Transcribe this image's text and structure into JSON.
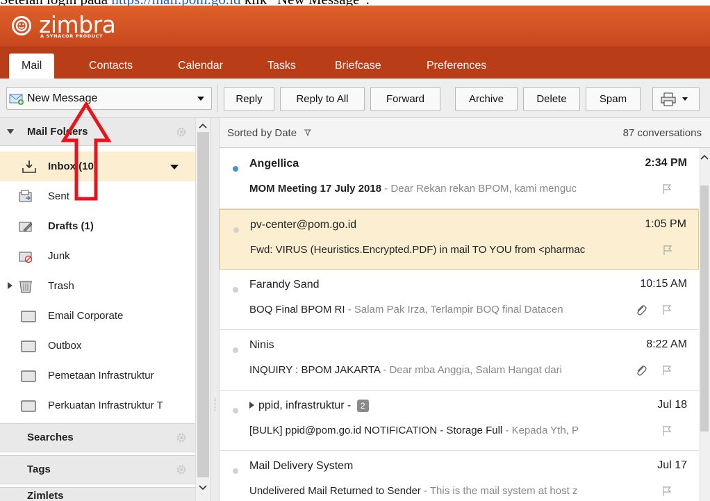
{
  "caption": {
    "prefix": "Setelah login pada ",
    "link": "https://mail.pom.go.id",
    "suffix": " klik “New Message”."
  },
  "header": {
    "logo_text": "zimbra",
    "logo_sub": "A SYNACOR PRODUCT"
  },
  "app_tabs": [
    "Mail",
    "Contacts",
    "Calendar",
    "Tasks",
    "Briefcase",
    "Preferences"
  ],
  "toolbar": {
    "new_message": "New Message",
    "buttons": [
      "Reply",
      "Reply to All",
      "Forward",
      "Archive",
      "Delete",
      "Spam"
    ]
  },
  "left_pane": {
    "mail_folders": "Mail Folders",
    "folders": [
      {
        "name": "Inbox (10)",
        "icon": "inbox-icon"
      },
      {
        "name": "Sent",
        "icon": "sent-icon"
      },
      {
        "name": "Drafts (1)",
        "icon": "drafts-icon"
      },
      {
        "name": "Junk",
        "icon": "junk-icon"
      },
      {
        "name": "Trash",
        "icon": "trash-icon"
      },
      {
        "name": "Email Corporate",
        "icon": "folder-icon"
      },
      {
        "name": "Outbox",
        "icon": "folder-icon"
      },
      {
        "name": "Pemetaan Infrastruktur",
        "icon": "folder-icon"
      },
      {
        "name": "Perkuatan Infrastruktur T",
        "icon": "folder-icon"
      }
    ],
    "searches": "Searches",
    "tags": "Tags",
    "zimlets": "Zimlets"
  },
  "message_list": {
    "sort_label": "Sorted by Date",
    "count": "87 conversations",
    "messages": [
      {
        "from": "Angellica",
        "time": "2:34 PM",
        "subject": "MOM Meeting 17 July 2018",
        "snippet": " - Dear Rekan rekan BPOM, kami menguc"
      },
      {
        "from": "pv-center@pom.go.id",
        "time": "1:05 PM",
        "subject": "Fwd: VIRUS (Heuristics.Encrypted.PDF) in mail TO YOU from <pharmac",
        "snippet": ""
      },
      {
        "from": "Farandy Sand",
        "time": "10:15 AM",
        "subject": "BOQ Final BPOM RI",
        "snippet": " - Salam Pak Irza, Terlampir BOQ final Datacen"
      },
      {
        "from": "Ninis",
        "time": "8:22 AM",
        "subject": "INQUIRY : BPOM JAKARTA",
        "snippet": " - Dear mba Anggia, Salam Hangat dari"
      },
      {
        "from": "ppid, infrastruktur - ",
        "badge": "2",
        "time": "Jul 18",
        "subject": "[BULK]  ppid@pom.go.id NOTIFICATION - Storage Full",
        "snippet": " - Kepada Yth, P"
      },
      {
        "from": "Mail Delivery System",
        "time": "Jul 17",
        "subject": "Undelivered Mail Returned to Sender",
        "snippet": " - This is the mail system at host z"
      }
    ]
  },
  "colors": {
    "header_orange": "#d5542a",
    "tab_bar": "#b93e17",
    "selected_row": "#fcefd1",
    "unread_dot": "#4a90d9",
    "annotation_red": "#e8141b"
  }
}
